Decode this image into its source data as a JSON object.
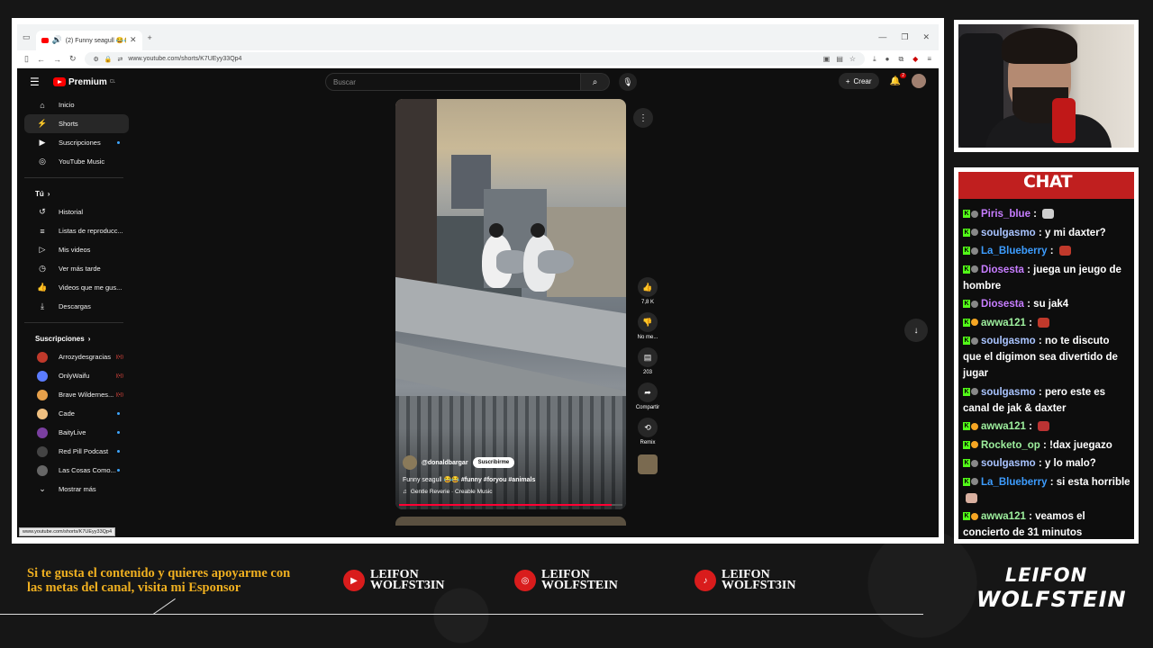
{
  "browser": {
    "tab_title": "(2) Funny seagull 😂😂 #f",
    "url": "www.youtube.com/shorts/K7UEyy33Qp4",
    "status_url": "www.youtube.com/shorts/K7UEyy33Qp4"
  },
  "yt": {
    "logo": "Premium",
    "logo_sup": "CL",
    "search_placeholder": "Buscar",
    "create_label": "Crear",
    "notif_count": "2"
  },
  "sidebar": {
    "main": [
      {
        "label": "Inicio",
        "icon": "home-icon"
      },
      {
        "label": "Shorts",
        "icon": "shorts-icon"
      },
      {
        "label": "Suscripciones",
        "icon": "subscriptions-icon"
      },
      {
        "label": "YouTube Music",
        "icon": "music-icon"
      }
    ],
    "you_header": "Tú",
    "you": [
      {
        "label": "Historial"
      },
      {
        "label": "Listas de reproducc..."
      },
      {
        "label": "Mis videos"
      },
      {
        "label": "Ver más tarde"
      },
      {
        "label": "Videos que me gus..."
      },
      {
        "label": "Descargas"
      }
    ],
    "subs_header": "Suscripciones",
    "subs": [
      {
        "label": "Arrozydesgracias",
        "color": "#c0392b"
      },
      {
        "label": "OnlyWaifu",
        "color": "#5b7cff"
      },
      {
        "label": "Brave Wildernes...",
        "color": "#e6a04a"
      },
      {
        "label": "Cade",
        "color": "#f0c080"
      },
      {
        "label": "BaityLive",
        "color": "#7a3fa0"
      },
      {
        "label": "Red Pill Podcast",
        "color": "#444"
      },
      {
        "label": "Las Cosas Como...",
        "color": "#666"
      }
    ],
    "show_more": "Mostrar más"
  },
  "video": {
    "channel": "@donaldbargar",
    "subscribe": "Suscribirme",
    "title_text": "Funny seagull 😂😂 ",
    "tags": "#funny #foryou #animals",
    "music": "Gentle Reverie · Creable Music",
    "likes": "7,8 K",
    "dislike_label": "No me...",
    "comments": "203",
    "share_label": "Compartir",
    "remix_label": "Remix",
    "progress": 0.95
  },
  "chat": {
    "header": "CHAT",
    "messages": [
      {
        "user": "Piris_blue",
        "text": "",
        "color": "u-purple",
        "emote": "#cfcfcf"
      },
      {
        "user": "soulgasmo",
        "text": "y mi daxter?",
        "color": "u-blue"
      },
      {
        "user": "La_Blueberry",
        "text": "",
        "color": "u-azure",
        "emote": "#c0392b"
      },
      {
        "user": "Diosesta",
        "text": "juega un jeugo de hombre",
        "color": "u-purple"
      },
      {
        "user": "Diosesta",
        "text": "su jak4",
        "color": "u-purple"
      },
      {
        "user": "awwa121",
        "text": "",
        "color": "u-green",
        "emote": "#c0392b"
      },
      {
        "user": "soulgasmo",
        "text": "no te discuto que el digimon sea divertido de jugar",
        "color": "u-blue"
      },
      {
        "user": "soulgasmo",
        "text": "pero este es canal de jak & daxter",
        "color": "u-blue"
      },
      {
        "user": "awwa121",
        "text": "",
        "color": "u-green",
        "emote": "#b33"
      },
      {
        "user": "Rocketo_op",
        "text": "!dax juegazo",
        "color": "u-green"
      },
      {
        "user": "soulgasmo",
        "text": "y lo malo?",
        "color": "u-blue"
      },
      {
        "user": "La_Blueberry",
        "text": "si esta horrible",
        "color": "u-azure",
        "emote": "#d9b0a0"
      },
      {
        "user": "awwa121",
        "text": "veamos el concierto de 31 minutos",
        "color": "u-green"
      }
    ]
  },
  "overlay": {
    "sponsor_text": "Si te gusta el contenido y quieres apoyarme con las metas del canal, visita mi Esponsor",
    "social": [
      {
        "name_line1": "LEIFON",
        "name_line2": "WOLFST3IN",
        "icon": "youtube-icon"
      },
      {
        "name_line1": "LEIFON",
        "name_line2": "WOLFSTEIN",
        "icon": "instagram-icon"
      },
      {
        "name_line1": "LEIFON",
        "name_line2": "WOLFST3IN",
        "icon": "tiktok-icon"
      }
    ],
    "brand_line1": "LEIFON",
    "brand_line2": "WOLFSTEIN"
  }
}
